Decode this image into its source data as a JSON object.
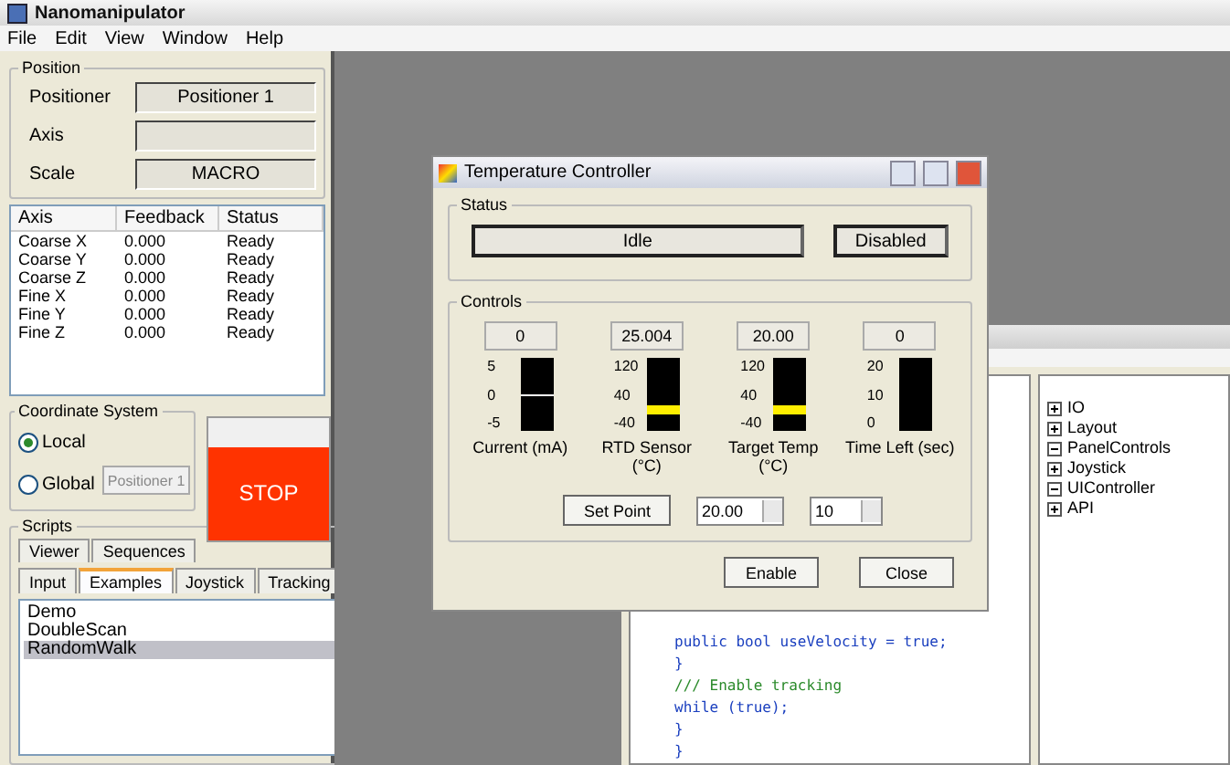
{
  "window": {
    "title": "Nanomanipulator"
  },
  "menu": [
    "File",
    "Edit",
    "View",
    "Window",
    "Help"
  ],
  "position": {
    "title": "Position",
    "fields": [
      {
        "label": "Positioner",
        "value": "Positioner 1"
      },
      {
        "label": "Axis"
      },
      {
        "label": "Scale",
        "value": "MACRO"
      }
    ]
  },
  "axes_table": {
    "columns": [
      "Axis",
      "Feedback",
      "Status"
    ],
    "rows": [
      [
        "Coarse X",
        "0.000",
        "Ready"
      ],
      [
        "Coarse Y",
        "0.000",
        "Ready"
      ],
      [
        "Coarse Z",
        "0.000",
        "Ready"
      ],
      [
        "Fine X",
        "0.000",
        "Ready"
      ],
      [
        "Fine Y",
        "0.000",
        "Ready"
      ],
      [
        "Fine Z",
        "0.000",
        "Ready"
      ]
    ]
  },
  "coordinate_system": {
    "title": "Coordinate System",
    "options": [
      {
        "label": "Local",
        "selected": true
      },
      {
        "label": "Global",
        "selected": false
      }
    ],
    "dropdown": "Positioner 1"
  },
  "stop_button": "STOP",
  "scripts": {
    "title": "Scripts",
    "tab_rows": [
      [
        {
          "label": "Viewer",
          "selected": false
        },
        {
          "label": "Sequences",
          "selected": false
        }
      ],
      [
        {
          "label": "Input",
          "selected": false
        },
        {
          "label": "Examples",
          "selected": true
        },
        {
          "label": "Joystick",
          "selected": false
        },
        {
          "label": "Tracking",
          "selected": false
        }
      ]
    ],
    "items": [
      {
        "label": "Demo",
        "selected": false
      },
      {
        "label": "DoubleScan",
        "selected": false
      },
      {
        "label": "RandomWalk",
        "selected": true
      }
    ]
  },
  "editor": {
    "tree": [
      {
        "label": "IO",
        "expanded": false
      },
      {
        "label": "Layout",
        "expanded": false
      },
      {
        "label": "PanelControls",
        "expanded": true
      },
      {
        "label": "Joystick",
        "expanded": false
      },
      {
        "label": "UIController",
        "expanded": true
      },
      {
        "label": "API",
        "expanded": false
      }
    ],
    "code": [
      {
        "text": "public bool useVelocity = true;",
        "kind": "code"
      },
      {
        "text": "}",
        "kind": "code"
      },
      {
        "text": "/// Enable tracking",
        "kind": "comment"
      },
      {
        "text": "while (true);",
        "kind": "code"
      },
      {
        "text": "}",
        "kind": "code"
      },
      {
        "text": "}",
        "kind": "code"
      }
    ]
  },
  "dialog": {
    "title": "Temperature Controller",
    "status_title": "Status",
    "status": "Idle",
    "mode": "Disabled",
    "controls_title": "Controls",
    "gauges": [
      {
        "value": "0",
        "ticks": [
          "5",
          "0",
          "-5"
        ],
        "label": "Current (mA)",
        "kind": "line",
        "level": 0.5
      },
      {
        "value": "25.004",
        "ticks": [
          "120",
          "40",
          "-40"
        ],
        "label": "RTD Sensor (°C)",
        "kind": "band",
        "level": 0.3
      },
      {
        "value": "20.00",
        "ticks": [
          "120",
          "40",
          "-40"
        ],
        "label": "Target Temp (°C)",
        "kind": "band",
        "level": 0.28
      },
      {
        "value": "0",
        "ticks": [
          "20",
          "10",
          "0"
        ],
        "label": "Time Left (sec)",
        "kind": "none"
      }
    ],
    "set_point_button": "Set Point",
    "target_input": "20.00",
    "time_input": "10",
    "buttons": [
      "Enable",
      "Close"
    ]
  }
}
